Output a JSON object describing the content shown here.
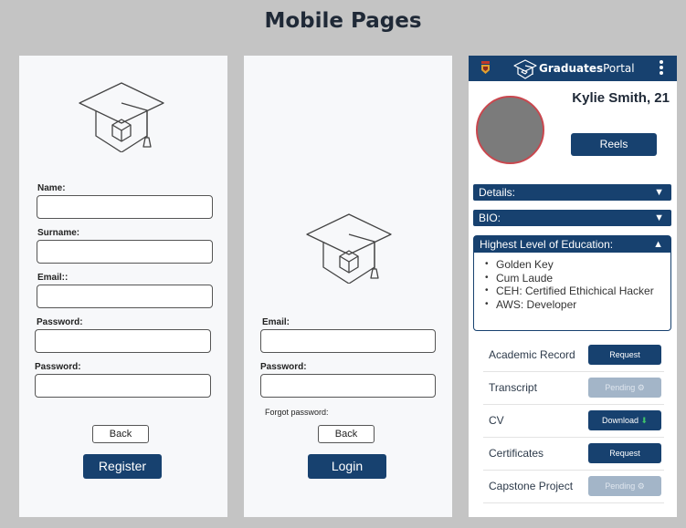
{
  "page": {
    "title": "Mobile Pages"
  },
  "register": {
    "fields": [
      {
        "label": "Name:"
      },
      {
        "label": "Surname:"
      },
      {
        "label": "Email::"
      },
      {
        "label": "Password:"
      },
      {
        "label": "Password:"
      }
    ],
    "back_label": "Back",
    "submit_label": "Register"
  },
  "login": {
    "fields": [
      {
        "label": "Email:"
      },
      {
        "label": "Password:"
      }
    ],
    "forgot_label": "Forgot password:",
    "back_label": "Back",
    "submit_label": "Login"
  },
  "profile": {
    "brand_bold": "Graduates",
    "brand_light": "Portal",
    "name": "Kylie Smith, 21",
    "reels_label": "Reels",
    "sections": [
      {
        "label": "Details:",
        "icon": "triangle-down-icon",
        "glyph": "▼"
      },
      {
        "label": "BIO:",
        "icon": "triangle-down-icon",
        "glyph": "▼"
      }
    ],
    "education": {
      "heading": "Highest Level of Education:",
      "glyph": "▲",
      "items": [
        "Golden Key",
        "Cum Laude",
        "CEH: Certified Ethichical Hacker",
        "AWS: Developer"
      ]
    },
    "documents": [
      {
        "label": "Academic Record",
        "action": "Request",
        "status": "active",
        "icon": ""
      },
      {
        "label": "Transcript",
        "action": "Pending",
        "status": "pending",
        "icon": "⚙"
      },
      {
        "label": "CV",
        "action": "Download",
        "status": "active",
        "icon": "⬇"
      },
      {
        "label": "Certificates",
        "action": "Request",
        "status": "active",
        "icon": ""
      },
      {
        "label": "Capstone Project",
        "action": "Pending",
        "status": "pending",
        "icon": "⚙"
      }
    ],
    "colors": {
      "primary": "#17416f",
      "pending": "#a3b5c8",
      "avatar_ring": "#c9474e"
    }
  }
}
